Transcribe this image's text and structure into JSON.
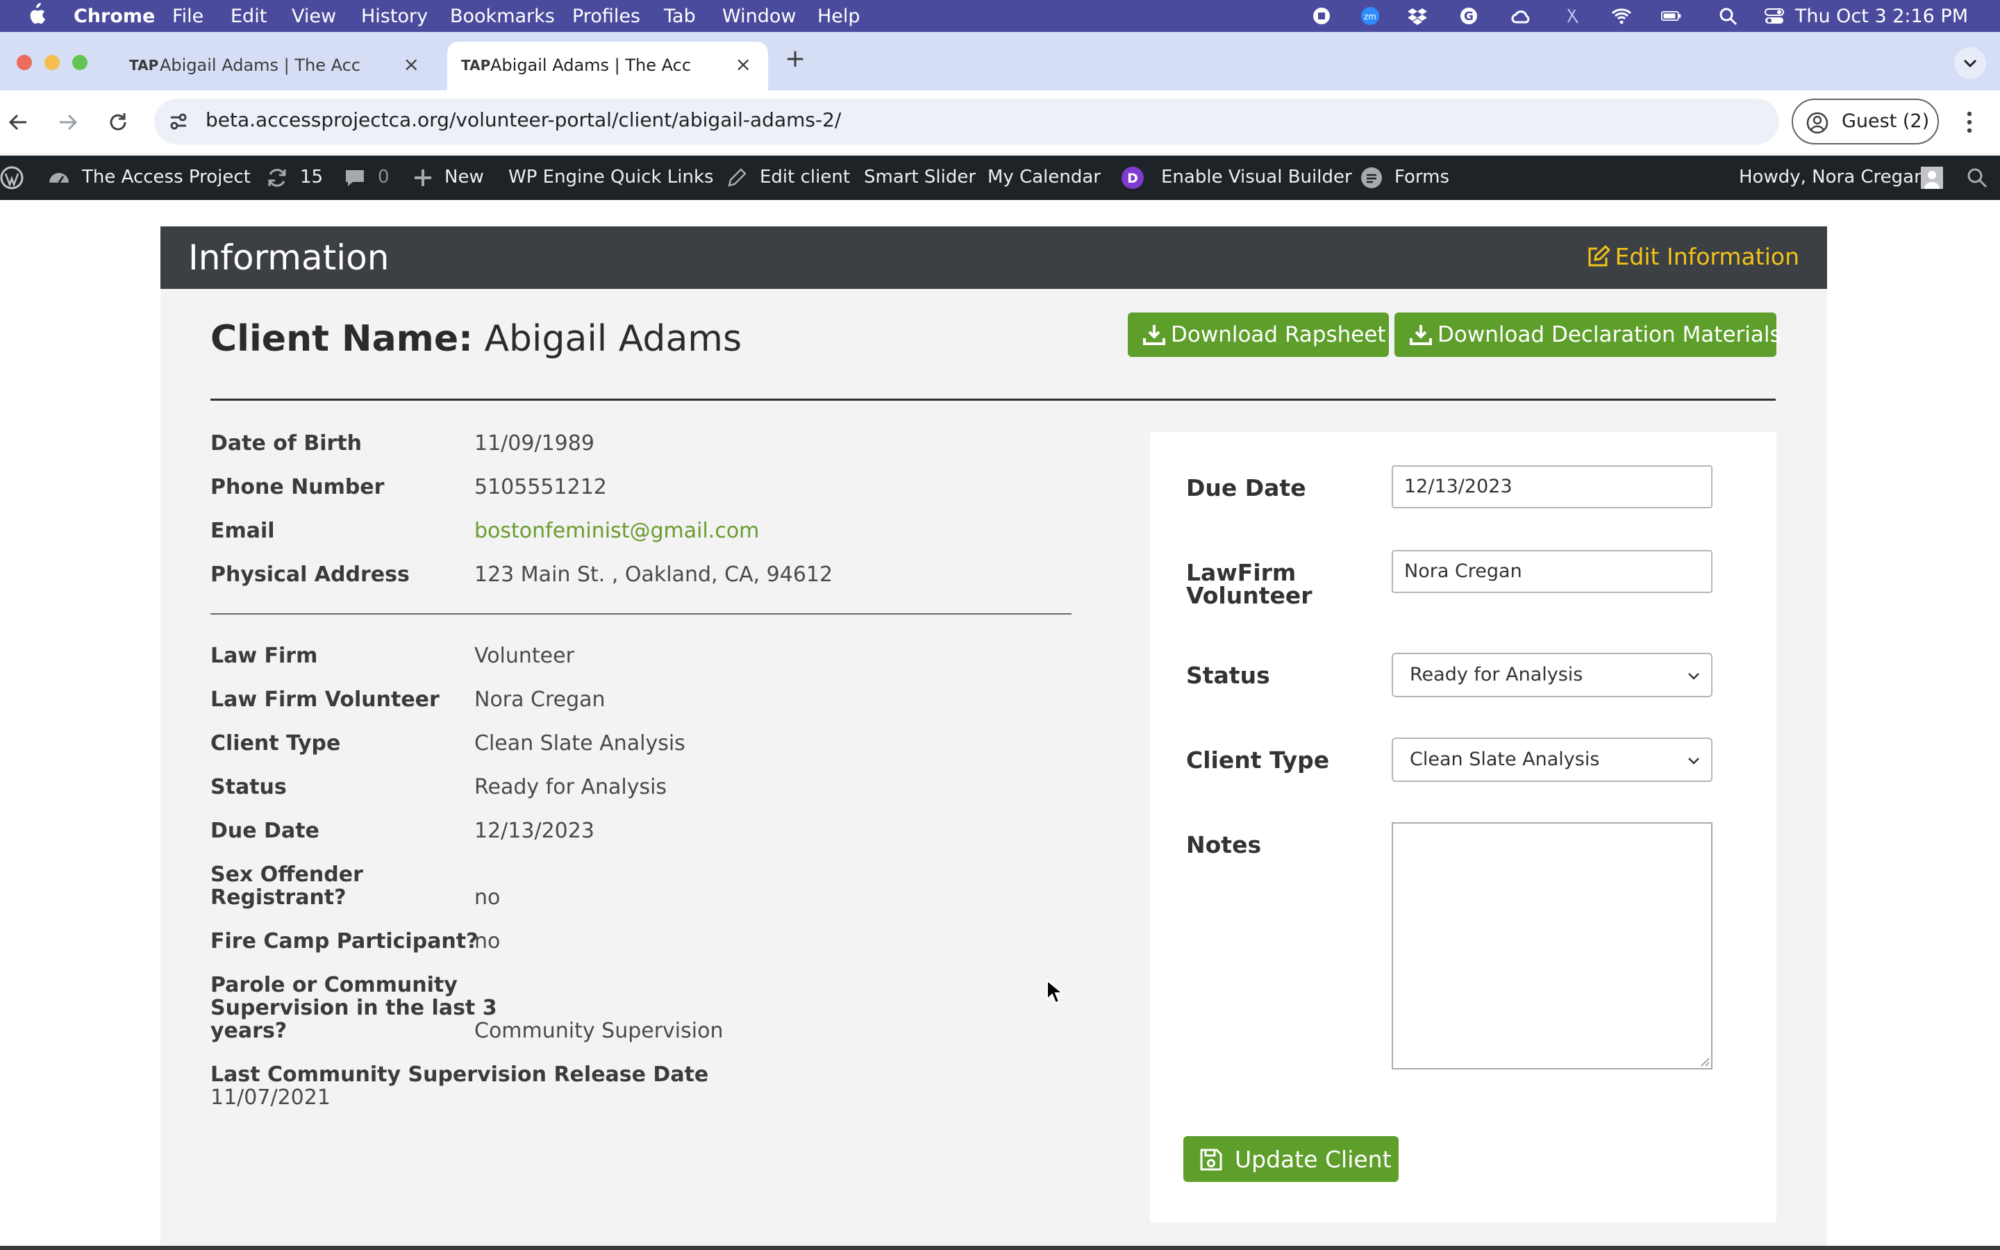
{
  "menubar": {
    "app": "Chrome",
    "items": [
      "File",
      "Edit",
      "View",
      "History",
      "Bookmarks",
      "Profiles",
      "Tab",
      "Window",
      "Help"
    ],
    "clock": "Thu Oct 3  2:16 PM",
    "zoom_badge": "zm"
  },
  "tabs": [
    {
      "favicon": "TAP",
      "title": "Abigail Adams | The Access P"
    },
    {
      "favicon": "TAP",
      "title": "Abigail Adams | The Access P"
    }
  ],
  "toolbar": {
    "url": "beta.accessprojectca.org/volunteer-portal/client/abigail-adams-2/",
    "profile_label": "Guest (2)"
  },
  "wpbar": {
    "site_name": "The Access Project",
    "updates_count": "15",
    "comments_count": "0",
    "new_label": "New",
    "quick_links": "WP Engine Quick Links",
    "edit_client": "Edit client",
    "smart_slider": "Smart Slider",
    "my_calendar": "My Calendar",
    "divi_badge": "D",
    "visual_builder": "Enable Visual Builder",
    "forms": "Forms",
    "howdy": "Howdy, Nora Cregan"
  },
  "panel": {
    "title": "Information",
    "edit_label": "Edit Information",
    "client_name_label": "Client Name:",
    "client_name": "Abigail Adams",
    "download_rapsheet": "Download Rapsheet",
    "download_declaration": "Download Declaration Materials"
  },
  "details": {
    "dob_label": "Date of Birth",
    "dob": "11/09/1989",
    "phone_label": "Phone Number",
    "phone": "5105551212",
    "email_label": "Email",
    "email": "bostonfeminist@gmail.com",
    "address_label": "Physical Address",
    "address": "123 Main St. , Oakland, CA, 94612",
    "law_firm_label": "Law Firm",
    "law_firm": "Volunteer",
    "volunteer_label": "Law Firm Volunteer",
    "volunteer": "Nora Cregan",
    "client_type_label": "Client Type",
    "client_type": "Clean Slate Analysis",
    "status_label": "Status",
    "status": "Ready for Analysis",
    "due_date_label": "Due Date",
    "due_date": "12/13/2023",
    "sex_offender_label_1": "Sex Offender",
    "sex_offender_label_2": "Registrant?",
    "sex_offender": "no",
    "fire_camp_label": "Fire Camp Participant?",
    "fire_camp": "no",
    "parole_label_1": "Parole or Community",
    "parole_label_2": "Supervision in the last 3",
    "parole_label_3": "years?",
    "parole": "Community Supervision",
    "last_release_label": "Last Community Supervision Release Date",
    "last_release": "11/07/2021"
  },
  "form": {
    "due_date_label": "Due Date",
    "due_date_value": "12/13/2023",
    "lawfirm_label_1": "LawFirm",
    "lawfirm_label_2": "Volunteer",
    "lawfirm_value": "Nora Cregan",
    "status_label": "Status",
    "status_value": "Ready for Analysis",
    "client_type_label": "Client Type",
    "client_type_value": "Clean Slate Analysis",
    "notes_label": "Notes",
    "notes_value": "",
    "update_button": "Update Client"
  },
  "colors": {
    "menubar": "#4b4b9e",
    "wpbar": "#1d2327",
    "panel_header": "#3c3f44",
    "accent_green": "#5e9e2a",
    "edit_yellow": "#f2c418",
    "link_green": "#6a9c2e"
  }
}
